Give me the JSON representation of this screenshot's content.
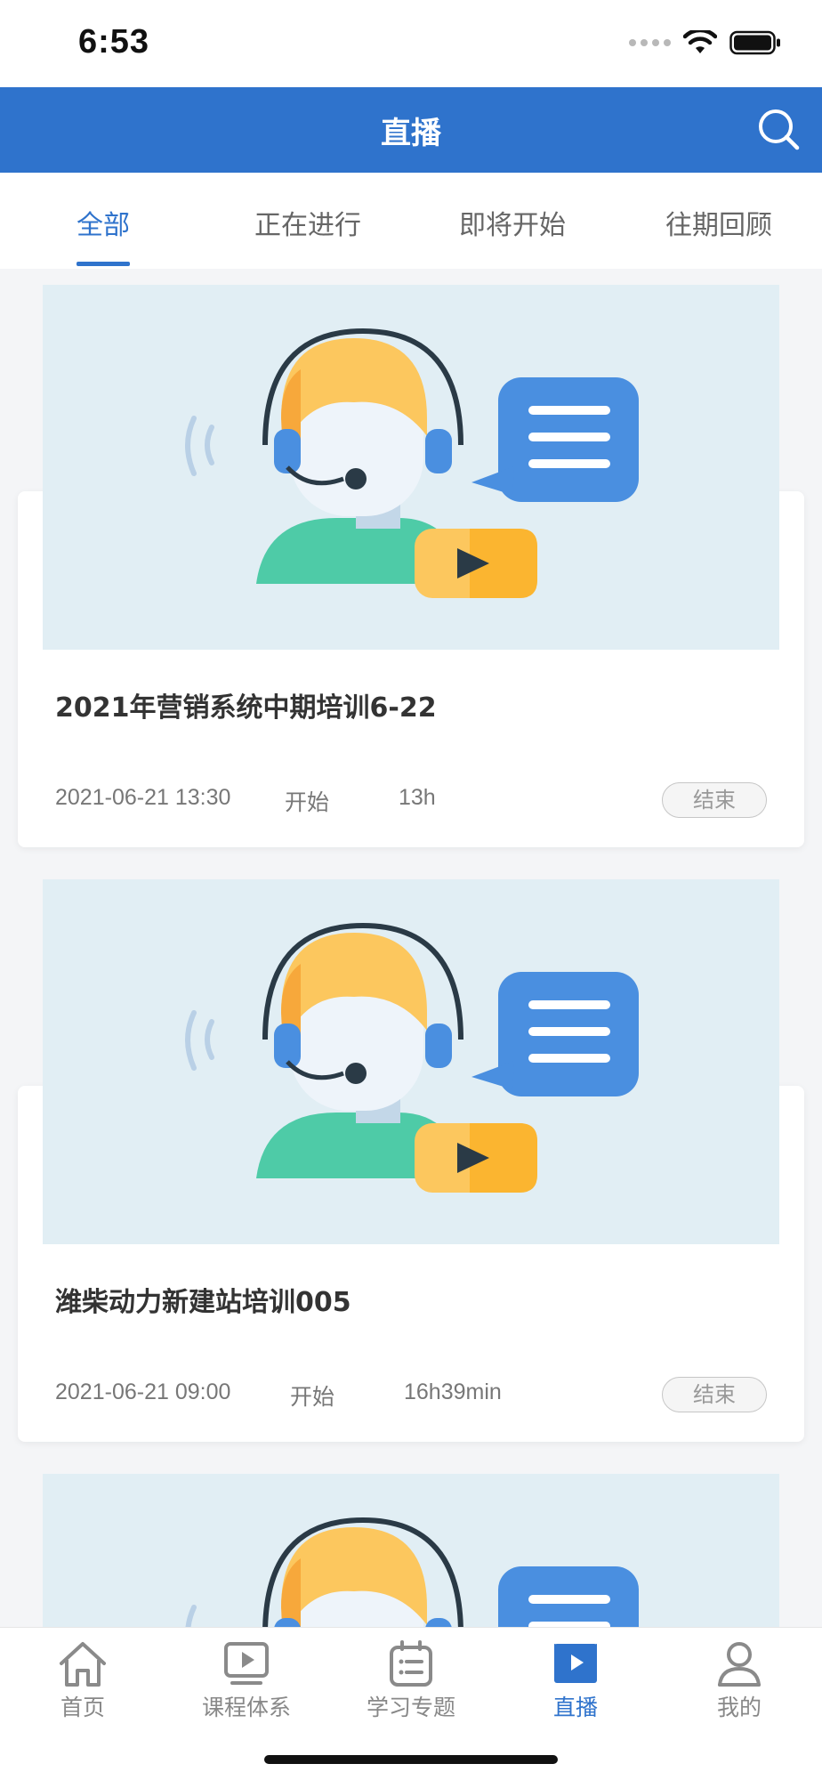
{
  "status_bar": {
    "time": "6:53"
  },
  "header": {
    "title": "直播"
  },
  "tabs": [
    {
      "label": "全部",
      "active": true
    },
    {
      "label": "正在进行",
      "active": false
    },
    {
      "label": "即将开始",
      "active": false
    },
    {
      "label": "往期回顾",
      "active": false
    }
  ],
  "cards": [
    {
      "title": "2021年营销系统中期培训6-22",
      "start_time": "2021-06-21 13:30",
      "start_word": "开始",
      "duration": "13h",
      "status": "结束"
    },
    {
      "title": "潍柴动力新建站培训005",
      "start_time": "2021-06-21 09:00",
      "start_word": "开始",
      "duration": "16h39min",
      "status": "结束"
    }
  ],
  "bottom_nav": [
    {
      "label": "首页",
      "icon": "home-icon",
      "active": false
    },
    {
      "label": "课程体系",
      "icon": "play-screen-icon",
      "active": false
    },
    {
      "label": "学习专题",
      "icon": "topic-list-icon",
      "active": false
    },
    {
      "label": "直播",
      "icon": "live-book-icon",
      "active": true
    },
    {
      "label": "我的",
      "icon": "person-icon",
      "active": false
    }
  ],
  "colors": {
    "brand_blue": "#2f73cc",
    "thumb_bg": "#e1eef4",
    "status_pill_border": "#c6c6c6"
  }
}
